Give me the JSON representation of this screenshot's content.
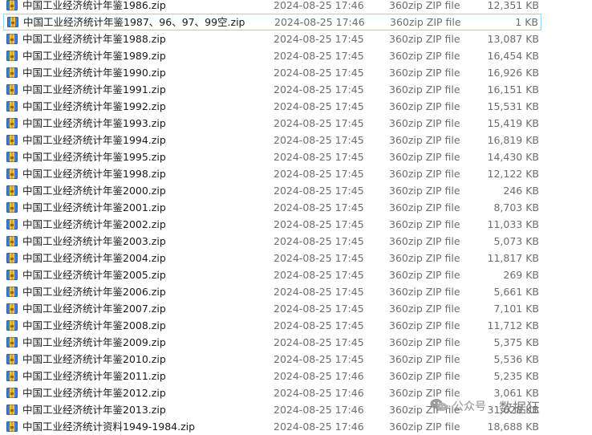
{
  "files": [
    {
      "name": "中国工业经济统计年鉴1986.zip",
      "date": "2024-08-25 17:46",
      "type": "360zip ZIP file",
      "size": "12,351 KB",
      "selected": false
    },
    {
      "name": "中国工业经济统计年鉴1987、96、97、99空.zip",
      "date": "2024-08-25 17:46",
      "type": "360zip ZIP file",
      "size": "1 KB",
      "selected": true
    },
    {
      "name": "中国工业经济统计年鉴1988.zip",
      "date": "2024-08-25 17:45",
      "type": "360zip ZIP file",
      "size": "13,087 KB",
      "selected": false
    },
    {
      "name": "中国工业经济统计年鉴1989.zip",
      "date": "2024-08-25 17:45",
      "type": "360zip ZIP file",
      "size": "16,454 KB",
      "selected": false
    },
    {
      "name": "中国工业经济统计年鉴1990.zip",
      "date": "2024-08-25 17:45",
      "type": "360zip ZIP file",
      "size": "16,926 KB",
      "selected": false
    },
    {
      "name": "中国工业经济统计年鉴1991.zip",
      "date": "2024-08-25 17:45",
      "type": "360zip ZIP file",
      "size": "16,151 KB",
      "selected": false
    },
    {
      "name": "中国工业经济统计年鉴1992.zip",
      "date": "2024-08-25 17:45",
      "type": "360zip ZIP file",
      "size": "15,531 KB",
      "selected": false
    },
    {
      "name": "中国工业经济统计年鉴1993.zip",
      "date": "2024-08-25 17:45",
      "type": "360zip ZIP file",
      "size": "15,419 KB",
      "selected": false
    },
    {
      "name": "中国工业经济统计年鉴1994.zip",
      "date": "2024-08-25 17:45",
      "type": "360zip ZIP file",
      "size": "16,819 KB",
      "selected": false
    },
    {
      "name": "中国工业经济统计年鉴1995.zip",
      "date": "2024-08-25 17:45",
      "type": "360zip ZIP file",
      "size": "14,430 KB",
      "selected": false
    },
    {
      "name": "中国工业经济统计年鉴1998.zip",
      "date": "2024-08-25 17:45",
      "type": "360zip ZIP file",
      "size": "12,122 KB",
      "selected": false
    },
    {
      "name": "中国工业经济统计年鉴2000.zip",
      "date": "2024-08-25 17:45",
      "type": "360zip ZIP file",
      "size": "246 KB",
      "selected": false
    },
    {
      "name": "中国工业经济统计年鉴2001.zip",
      "date": "2024-08-25 17:45",
      "type": "360zip ZIP file",
      "size": "8,703 KB",
      "selected": false
    },
    {
      "name": "中国工业经济统计年鉴2002.zip",
      "date": "2024-08-25 17:45",
      "type": "360zip ZIP file",
      "size": "11,033 KB",
      "selected": false
    },
    {
      "name": "中国工业经济统计年鉴2003.zip",
      "date": "2024-08-25 17:45",
      "type": "360zip ZIP file",
      "size": "5,073 KB",
      "selected": false
    },
    {
      "name": "中国工业经济统计年鉴2004.zip",
      "date": "2024-08-25 17:45",
      "type": "360zip ZIP file",
      "size": "11,817 KB",
      "selected": false
    },
    {
      "name": "中国工业经济统计年鉴2005.zip",
      "date": "2024-08-25 17:45",
      "type": "360zip ZIP file",
      "size": "269 KB",
      "selected": false
    },
    {
      "name": "中国工业经济统计年鉴2006.zip",
      "date": "2024-08-25 17:45",
      "type": "360zip ZIP file",
      "size": "5,661 KB",
      "selected": false
    },
    {
      "name": "中国工业经济统计年鉴2007.zip",
      "date": "2024-08-25 17:45",
      "type": "360zip ZIP file",
      "size": "7,101 KB",
      "selected": false
    },
    {
      "name": "中国工业经济统计年鉴2008.zip",
      "date": "2024-08-25 17:45",
      "type": "360zip ZIP file",
      "size": "11,712 KB",
      "selected": false
    },
    {
      "name": "中国工业经济统计年鉴2009.zip",
      "date": "2024-08-25 17:45",
      "type": "360zip ZIP file",
      "size": "5,375 KB",
      "selected": false
    },
    {
      "name": "中国工业经济统计年鉴2010.zip",
      "date": "2024-08-25 17:45",
      "type": "360zip ZIP file",
      "size": "5,536 KB",
      "selected": false
    },
    {
      "name": "中国工业经济统计年鉴2011.zip",
      "date": "2024-08-25 17:46",
      "type": "360zip ZIP file",
      "size": "5,235 KB",
      "selected": false
    },
    {
      "name": "中国工业经济统计年鉴2012.zip",
      "date": "2024-08-25 17:46",
      "type": "360zip ZIP file",
      "size": "3,061 KB",
      "selected": false
    },
    {
      "name": "中国工业经济统计年鉴2013.zip",
      "date": "2024-08-25 17:46",
      "type": "360zip ZIP file",
      "size": "31,628 KB",
      "selected": false
    },
    {
      "name": "中国工业经济统计资料1949-1984.zip",
      "date": "2024-08-25 17:46",
      "type": "360zip ZIP file",
      "size": "18,688 KB",
      "selected": false
    }
  ],
  "watermark": {
    "text_a": "公众号",
    "text_b": "数据狂"
  },
  "icon": "zip-archive-icon",
  "colors": {
    "selection_border": "#99d1ff",
    "meta_text": "#6d6d6d"
  }
}
